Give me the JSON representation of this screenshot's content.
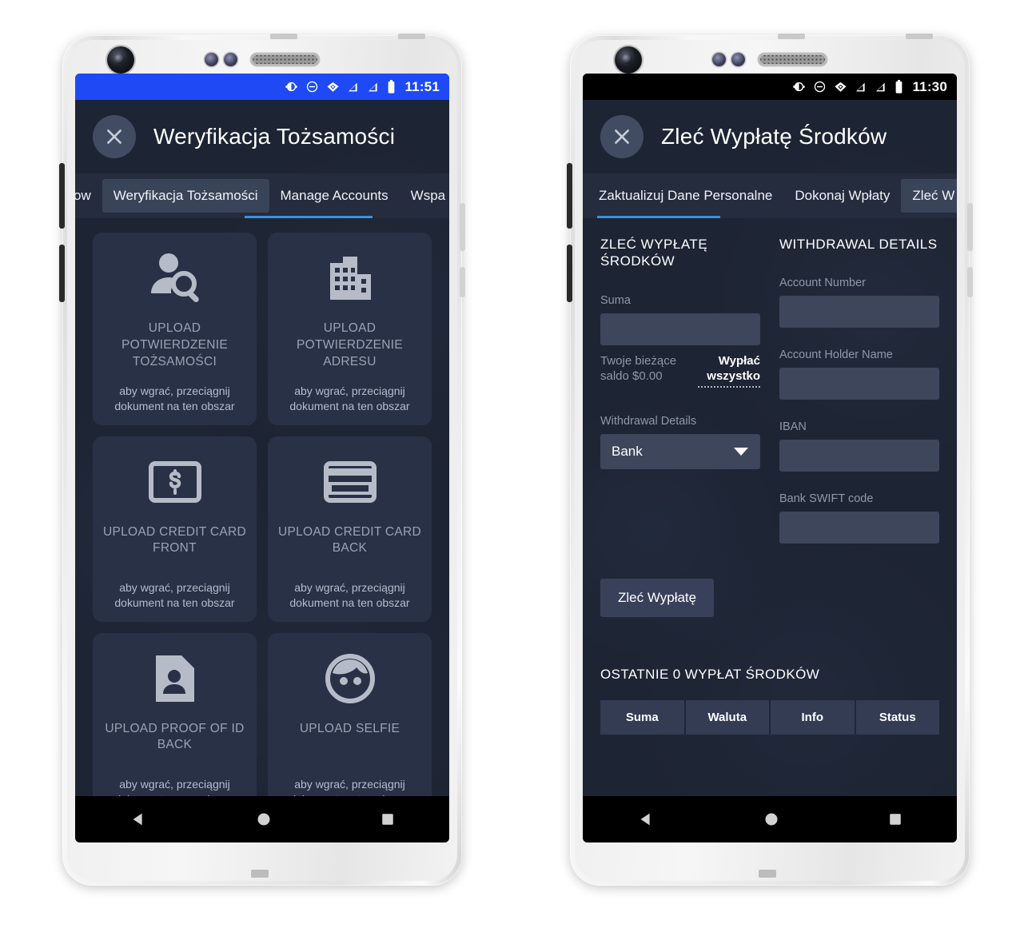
{
  "phones": [
    {
      "id": "identity-verification",
      "statusbar": {
        "style": "blue",
        "time": "11:51",
        "icons": [
          "contrast-icon",
          "do-not-disturb-icon",
          "wifi-icon",
          "signal-icon",
          "signal-icon",
          "battery-icon"
        ]
      },
      "appbar": {
        "close_label": "close-icon",
        "title": "Weryfikacja Tożsamości"
      },
      "tabs": {
        "items": [
          {
            "label": "ow",
            "active": false,
            "highlight": false
          },
          {
            "label": "Weryfikacja Tożsamości",
            "active": false,
            "highlight": true
          },
          {
            "label": "Manage Accounts",
            "active": true,
            "highlight": false
          },
          {
            "label": "Wspa",
            "active": false,
            "highlight": false
          }
        ]
      },
      "cards": [
        {
          "icon": "person-search-icon",
          "title": "UPLOAD POTWIERDZENIE TOŻSAMOŚCI",
          "hint": "aby wgrać, przeciągnij dokument na ten obszar"
        },
        {
          "icon": "building-icon",
          "title": "UPLOAD POTWIERDZENIE ADRESU",
          "hint": "aby wgrać, przeciągnij dokument na ten obszar"
        },
        {
          "icon": "money-card-icon",
          "title": "UPLOAD CREDIT CARD FRONT",
          "hint": "aby wgrać, przeciągnij dokument na ten obszar"
        },
        {
          "icon": "credit-card-icon",
          "title": "UPLOAD CREDIT CARD BACK",
          "hint": "aby wgrać, przeciągnij dokument na ten obszar"
        },
        {
          "icon": "id-document-icon",
          "title": "UPLOAD PROOF OF ID BACK",
          "hint": "aby wgrać, przeciągnij dokument na ten obszar"
        },
        {
          "icon": "selfie-face-icon",
          "title": "UPLOAD SELFIE",
          "hint": "aby wgrać, przeciągnij dokument na ten obszar"
        }
      ],
      "navbar": {
        "back": "back-triangle-icon",
        "home": "home-circle-icon",
        "recents": "recents-square-icon"
      }
    },
    {
      "id": "withdraw-funds",
      "statusbar": {
        "style": "black",
        "time": "11:30",
        "icons": [
          "contrast-icon",
          "do-not-disturb-icon",
          "wifi-icon",
          "signal-icon",
          "signal-icon",
          "battery-icon"
        ]
      },
      "appbar": {
        "close_label": "close-icon",
        "title": "Zleć Wypłatę Środków"
      },
      "tabs": {
        "items": [
          {
            "label": "Zaktualizuj Dane Personalne",
            "active": true,
            "highlight": false
          },
          {
            "label": "Dokonaj Wpłaty",
            "active": false,
            "highlight": false
          },
          {
            "label": "Zleć W",
            "active": false,
            "highlight": true
          }
        ]
      },
      "form": {
        "left_title": "ZLEĆ WYPŁATĘ ŚRODKÓW",
        "amount_label": "Suma",
        "amount_value": "",
        "amount_placeholder": "",
        "balance_text": "Twoje bieżące saldo $0.00",
        "withdraw_all_label": "Wypłać wszystko",
        "method_label": "Withdrawal Details",
        "method_value": "Bank",
        "method_options": [
          "Bank"
        ],
        "right_title": "WITHDRAWAL DETAILS",
        "fields": [
          {
            "label": "Account Number",
            "value": ""
          },
          {
            "label": "Account Holder Name",
            "value": ""
          },
          {
            "label": "IBAN",
            "value": ""
          },
          {
            "label": "Bank SWIFT code",
            "value": ""
          }
        ],
        "submit_label": "Zleć Wypłatę"
      },
      "recent": {
        "title": "OSTATNIE 0 WYPŁAT ŚRODKÓW",
        "columns": [
          "Suma",
          "Waluta",
          "Info",
          "Status"
        ],
        "rows": []
      },
      "navbar": {
        "back": "back-triangle-icon",
        "home": "home-circle-icon",
        "recents": "recents-square-icon"
      }
    }
  ],
  "colors": {
    "status_blue": "#1e49f5",
    "app_bg": "#1d2433",
    "card_bg": "#293146",
    "input_bg": "#3e465c",
    "tab_active_underline": "#3f8fd6",
    "tabstrip_bg": "#242c3d",
    "table_header_bg": "#333c52",
    "muted_text": "#8f98aa"
  }
}
